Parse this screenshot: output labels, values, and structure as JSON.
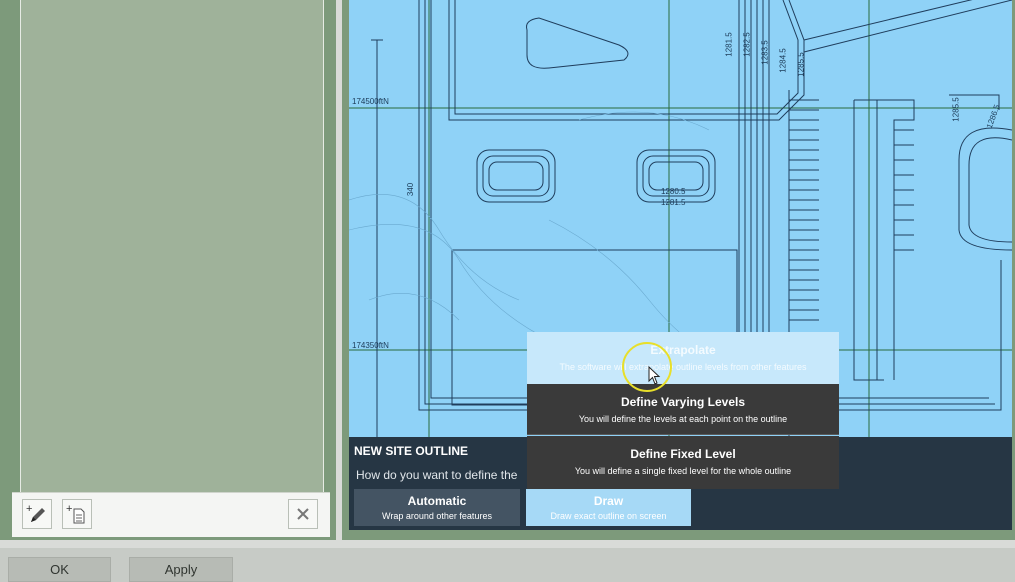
{
  "map": {
    "coord_labels": [
      "174500ftN",
      "174350ftN"
    ],
    "dimension_label": "340",
    "contour_labels": [
      "1281.5",
      "1282.5",
      "1283.5",
      "1284.5",
      "1285.5",
      "1280.5",
      "1281.5",
      "1285.5",
      "1286.5"
    ]
  },
  "overlay": {
    "title": "NEW SITE OUTLINE",
    "question": "How do you want to define the",
    "automatic": {
      "label": "Automatic",
      "sub": "Wrap around other features"
    },
    "draw": {
      "label": "Draw",
      "sub": "Draw exact outline on screen"
    }
  },
  "popup": {
    "options": [
      {
        "label": "Extrapolate",
        "sub": "The software will extrapolate outline levels from other features"
      },
      {
        "label": "Define Varying Levels",
        "sub": "You will define the levels at each point on the outline"
      },
      {
        "label": "Define Fixed Level",
        "sub": "You will define a single fixed level for the whole outline"
      }
    ]
  },
  "footer": {
    "ok": "OK",
    "apply": "Apply"
  },
  "icons": {
    "add_outline": "pencil-add-icon",
    "add_file": "document-add-icon",
    "delete": "close-icon",
    "cursor": "mouse-pointer-icon"
  },
  "colors": {
    "map_bg": "#8fd2f7",
    "panel": "#9fb29a",
    "overlay": "#263644",
    "popup": "#3a3a3a"
  }
}
